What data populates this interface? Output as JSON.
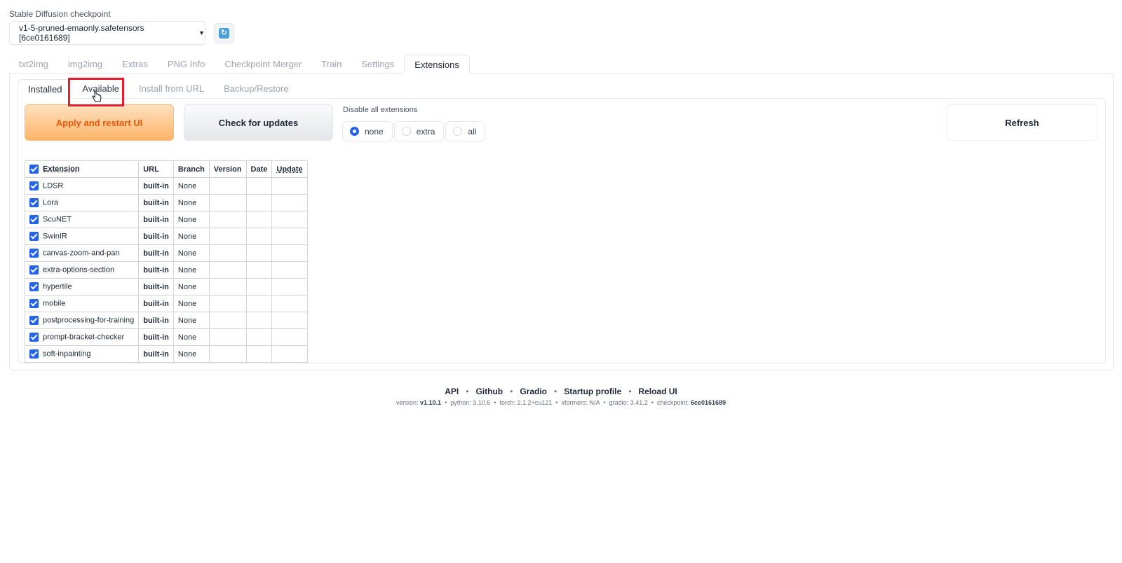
{
  "checkpoint": {
    "label": "Stable Diffusion checkpoint",
    "value": "v1-5-pruned-emaonly.safetensors [6ce0161689]"
  },
  "main_tabs": [
    "txt2img",
    "img2img",
    "Extras",
    "PNG Info",
    "Checkpoint Merger",
    "Train",
    "Settings",
    "Extensions"
  ],
  "main_tab_active": "Extensions",
  "sub_tabs": [
    "Installed",
    "Available",
    "Install from URL",
    "Backup/Restore"
  ],
  "sub_tab_active": "Installed",
  "highlight_tab": "Available",
  "buttons": {
    "apply": "Apply and restart UI",
    "check_updates": "Check for updates",
    "refresh": "Refresh"
  },
  "disable": {
    "label": "Disable all extensions",
    "options": [
      "none",
      "extra",
      "all"
    ],
    "selected": "none"
  },
  "table": {
    "headers": [
      "Extension",
      "URL",
      "Branch",
      "Version",
      "Date",
      "Update"
    ],
    "rows": [
      {
        "name": "LDSR",
        "url": "built-in",
        "branch": "None",
        "version": "",
        "date": "",
        "update": ""
      },
      {
        "name": "Lora",
        "url": "built-in",
        "branch": "None",
        "version": "",
        "date": "",
        "update": ""
      },
      {
        "name": "ScuNET",
        "url": "built-in",
        "branch": "None",
        "version": "",
        "date": "",
        "update": ""
      },
      {
        "name": "SwinIR",
        "url": "built-in",
        "branch": "None",
        "version": "",
        "date": "",
        "update": ""
      },
      {
        "name": "canvas-zoom-and-pan",
        "url": "built-in",
        "branch": "None",
        "version": "",
        "date": "",
        "update": ""
      },
      {
        "name": "extra-options-section",
        "url": "built-in",
        "branch": "None",
        "version": "",
        "date": "",
        "update": ""
      },
      {
        "name": "hypertile",
        "url": "built-in",
        "branch": "None",
        "version": "",
        "date": "",
        "update": ""
      },
      {
        "name": "mobile",
        "url": "built-in",
        "branch": "None",
        "version": "",
        "date": "",
        "update": ""
      },
      {
        "name": "postprocessing-for-training",
        "url": "built-in",
        "branch": "None",
        "version": "",
        "date": "",
        "update": ""
      },
      {
        "name": "prompt-bracket-checker",
        "url": "built-in",
        "branch": "None",
        "version": "",
        "date": "",
        "update": ""
      },
      {
        "name": "soft-inpainting",
        "url": "built-in",
        "branch": "None",
        "version": "",
        "date": "",
        "update": ""
      }
    ]
  },
  "footer": {
    "links": [
      "API",
      "Github",
      "Gradio",
      "Startup profile",
      "Reload UI"
    ],
    "versions": [
      {
        "label": "version:",
        "value": "v1.10.1",
        "bold": true
      },
      {
        "label": "python:",
        "value": "3.10.6",
        "bold": false
      },
      {
        "label": "torch:",
        "value": "2.1.2+cu121",
        "bold": false
      },
      {
        "label": "xformers:",
        "value": "N/A",
        "bold": false
      },
      {
        "label": "gradio:",
        "value": "3.41.2",
        "bold": false
      },
      {
        "label": "checkpoint:",
        "value": "6ce0161689",
        "bold": true
      }
    ]
  },
  "colors": {
    "highlight_box": "#e11d2e",
    "accent": "#2563eb",
    "apply_text": "#ea580c"
  }
}
